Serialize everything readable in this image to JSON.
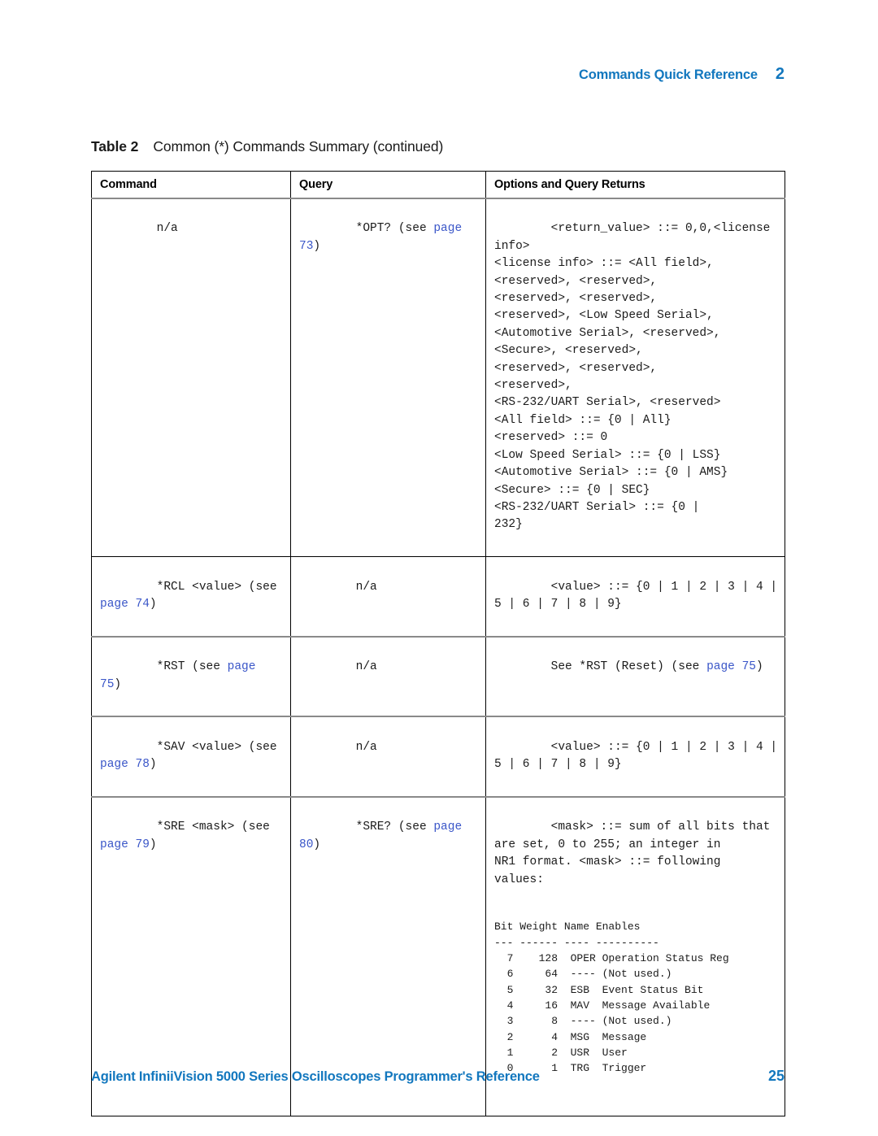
{
  "header": {
    "chapter_title": "Commands Quick Reference",
    "chapter_number": "2"
  },
  "caption": {
    "label": "Table 2",
    "text": "Common (*) Commands Summary (continued)"
  },
  "table": {
    "columns": [
      "Command",
      "Query",
      "Options and Query Returns"
    ],
    "rows": [
      {
        "command": "n/a",
        "query_pre": "*OPT? (see ",
        "query_link": "page 73",
        "query_post": ")",
        "options": "<return_value> ::= 0,0,<license\ninfo>\n<license info> ::= <All field>,\n<reserved>, <reserved>,\n<reserved>, <reserved>,\n<reserved>, <Low Speed Serial>,\n<Automotive Serial>, <reserved>,\n<Secure>, <reserved>,\n<reserved>, <reserved>,\n<reserved>,\n<RS-232/UART Serial>, <reserved>\n<All field> ::= {0 | All}\n<reserved> ::= 0\n<Low Speed Serial> ::= {0 | LSS}\n<Automotive Serial> ::= {0 | AMS}\n<Secure> ::= {0 | SEC}\n<RS-232/UART Serial> ::= {0 |\n232}"
      },
      {
        "command_pre": "*RCL <value> (see\n",
        "command_link": "page 74",
        "command_post": ")",
        "query": "n/a",
        "options": "<value> ::= {0 | 1 | 2 | 3 | 4 |\n5 | 6 | 7 | 8 | 9}"
      },
      {
        "command_pre": "*RST (see ",
        "command_link": "page 75",
        "command_post": ")",
        "query": "n/a",
        "options_pre": "See *RST (Reset) (see ",
        "options_link": "page 75",
        "options_post": ")"
      },
      {
        "command_pre": "*SAV <value> (see\n",
        "command_link": "page 78",
        "command_post": ")",
        "query": "n/a",
        "options": "<value> ::= {0 | 1 | 2 | 3 | 4 |\n5 | 6 | 7 | 8 | 9}"
      },
      {
        "command_pre": "*SRE <mask> (see\n",
        "command_link": "page 79",
        "command_post": ")",
        "query_pre": "*SRE? (see ",
        "query_link": "page 80",
        "query_post": ")",
        "options": "<mask> ::= sum of all bits that\nare set, 0 to 255; an integer in\nNR1 format. <mask> ::= following\nvalues:",
        "bit_table": "Bit Weight Name Enables\n--- ------ ---- ----------\n  7    128  OPER Operation Status Reg\n  6     64  ---- (Not used.)\n  5     32  ESB  Event Status Bit\n  4     16  MAV  Message Available\n  3      8  ---- (Not used.)\n  2      4  MSG  Message\n  1      2  USR  User\n  0      1  TRG  Trigger"
      }
    ]
  },
  "footer": {
    "book_title": "Agilent InfiniiVision 5000 Series Oscilloscopes Programmer's Reference",
    "page_number": "25"
  },
  "colors": {
    "brand_blue": "#1277be",
    "link_blue": "#3a56c8"
  }
}
